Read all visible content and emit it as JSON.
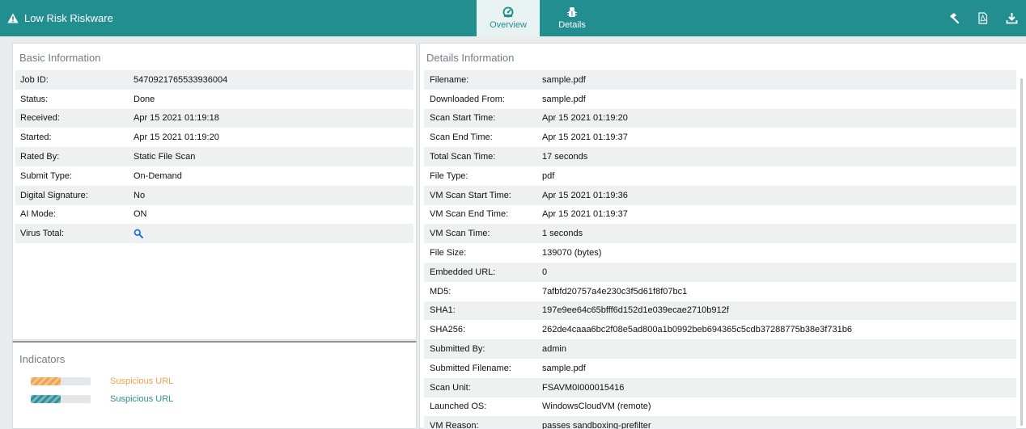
{
  "header": {
    "title": "Low Risk Riskware",
    "tabs": [
      {
        "label": "Overview",
        "active": true,
        "icon": "dashboard-icon"
      },
      {
        "label": "Details",
        "active": false,
        "icon": "bug-icon"
      }
    ],
    "actions": [
      "hammer-icon",
      "pdf-icon",
      "download-icon"
    ],
    "color": "#238e90"
  },
  "basic": {
    "title": "Basic Information",
    "rows": [
      {
        "label": "Job ID:",
        "value": "5470921765533936004"
      },
      {
        "label": "Status:",
        "value": "Done"
      },
      {
        "label": "Received:",
        "value": "Apr 15 2021 01:19:18"
      },
      {
        "label": "Started:",
        "value": "Apr 15 2021 01:19:20"
      },
      {
        "label": "Rated By:",
        "value": "Static File Scan"
      },
      {
        "label": "Submit Type:",
        "value": "On-Demand"
      },
      {
        "label": "Digital Signature:",
        "value": "No"
      },
      {
        "label": "AI Mode:",
        "value": "ON"
      },
      {
        "label": "Virus Total:",
        "value": ""
      }
    ]
  },
  "indicators": {
    "title": "Indicators",
    "items": [
      {
        "label": "Suspicious URL",
        "color": "#f0a24a",
        "level": 0.5
      },
      {
        "label": "Suspicious URL",
        "color": "#2e8f9a",
        "level": 0.5
      }
    ]
  },
  "details": {
    "title": "Details Information",
    "rows": [
      {
        "label": "Filename:",
        "value": "sample.pdf"
      },
      {
        "label": "Downloaded From:",
        "value": "sample.pdf"
      },
      {
        "label": "Scan Start Time:",
        "value": "Apr 15 2021 01:19:20"
      },
      {
        "label": "Scan End Time:",
        "value": "Apr 15 2021 01:19:37"
      },
      {
        "label": "Total Scan Time:",
        "value": "17 seconds"
      },
      {
        "label": "File Type:",
        "value": "pdf"
      },
      {
        "label": "VM Scan Start Time:",
        "value": "Apr 15 2021 01:19:36"
      },
      {
        "label": "VM Scan End Time:",
        "value": "Apr 15 2021 01:19:37"
      },
      {
        "label": "VM Scan Time:",
        "value": "1 seconds"
      },
      {
        "label": "File Size:",
        "value": "139070 (bytes)"
      },
      {
        "label": "Embedded URL:",
        "value": "0"
      },
      {
        "label": "MD5:",
        "value": "7afbfd20757a4e230c3f5d61f8f07bc1"
      },
      {
        "label": "SHA1:",
        "value": "197e9ee64c65bfff6d152d1e039ecae2710b912f"
      },
      {
        "label": "SHA256:",
        "value": "262de4caaa6bc2f08e5ad800a1b0992beb694365c5cdb37288775b38e3f731b6"
      },
      {
        "label": "Submitted By:",
        "value": "admin"
      },
      {
        "label": "Submitted Filename:",
        "value": "sample.pdf"
      },
      {
        "label": "Scan Unit:",
        "value": "FSAVM0I000015416"
      },
      {
        "label": "Launched OS:",
        "value": "WindowsCloudVM (remote)"
      },
      {
        "label": "VM Reason:",
        "value": "passes sandboxing-prefilter"
      }
    ]
  }
}
